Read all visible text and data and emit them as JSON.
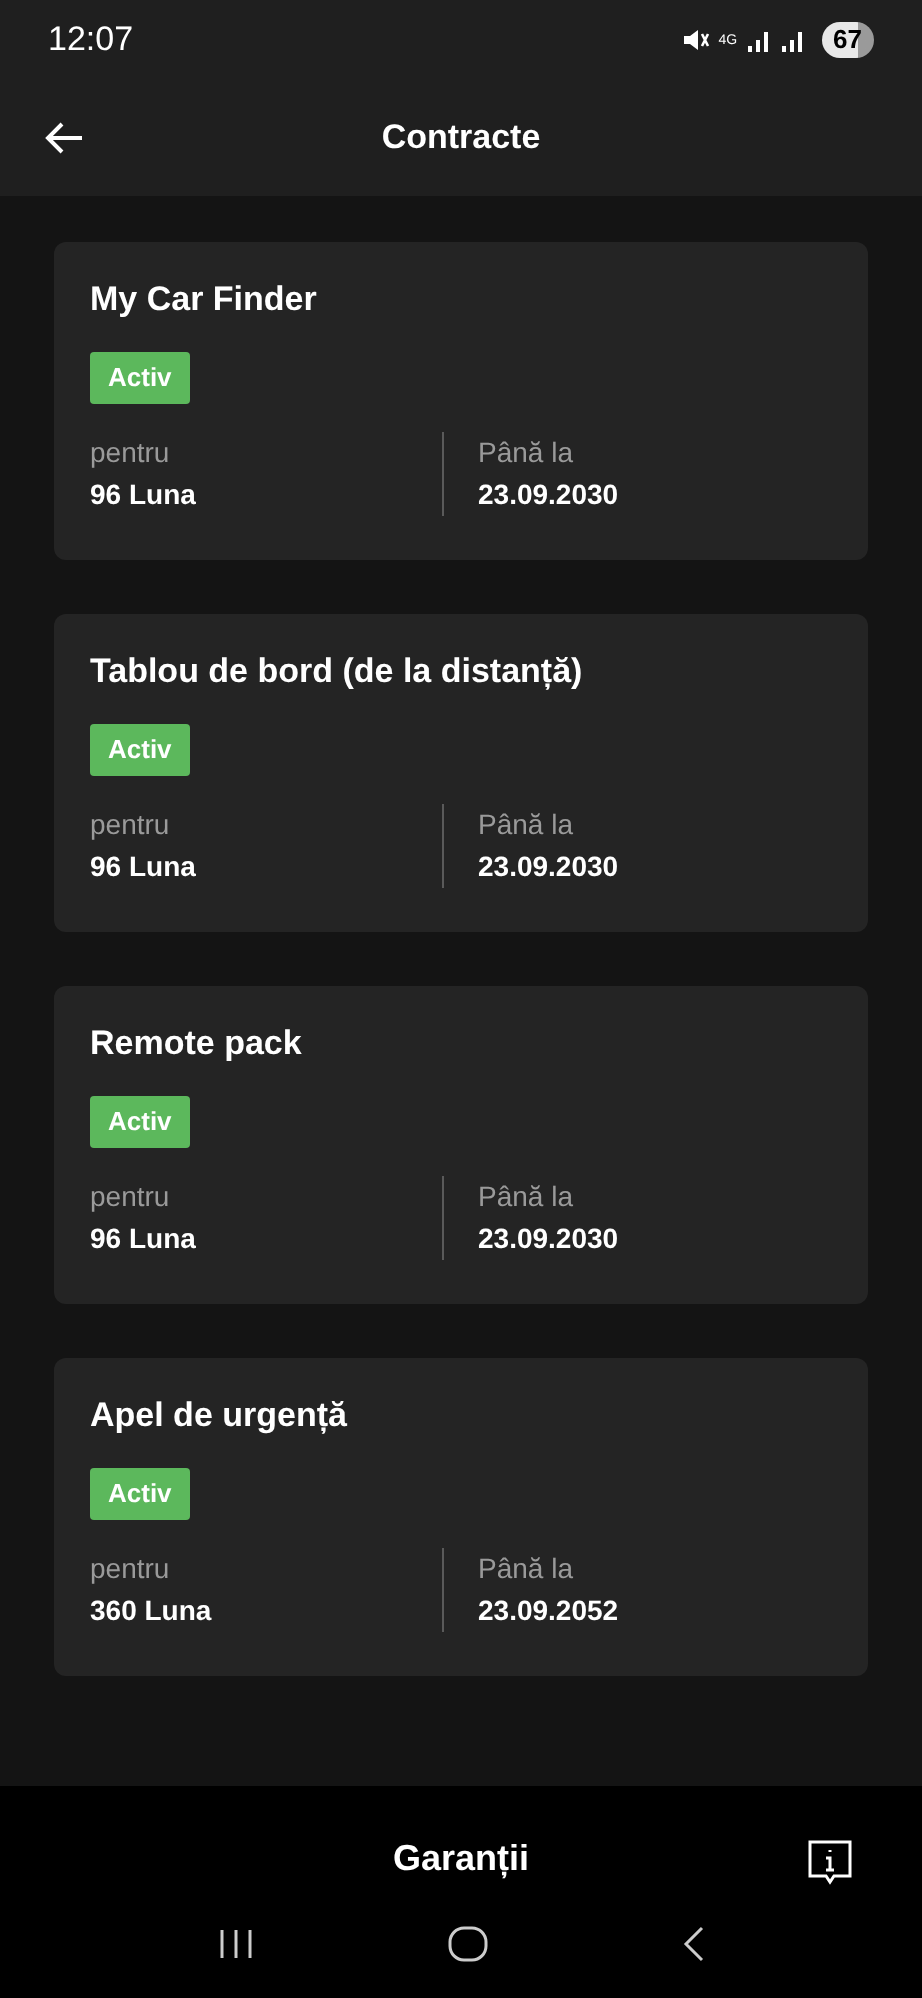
{
  "status_bar": {
    "time": "12:07",
    "network": "4G",
    "battery": "67"
  },
  "header": {
    "title": "Contracte"
  },
  "contracts": [
    {
      "name": "My Car Finder",
      "status": "Activ",
      "active": true,
      "duration_label": "pentru",
      "duration": "96 Luna",
      "end_label": "Până la",
      "end_date": "23.09.2030"
    },
    {
      "name": "Tablou de bord (de la distanță)",
      "status": "Activ",
      "active": true,
      "duration_label": "pentru",
      "duration": "96 Luna",
      "end_label": "Până la",
      "end_date": "23.09.2030"
    },
    {
      "name": "Remote pack",
      "status": "Activ",
      "active": true,
      "duration_label": "pentru",
      "duration": "96 Luna",
      "end_label": "Până la",
      "end_date": "23.09.2030"
    },
    {
      "name": "Apel de urgență",
      "status": "Activ",
      "active": true,
      "duration_label": "pentru",
      "duration": "360 Luna",
      "end_label": "Până la",
      "end_date": "23.09.2052"
    }
  ],
  "bottom_section": {
    "title": "Garanții"
  }
}
